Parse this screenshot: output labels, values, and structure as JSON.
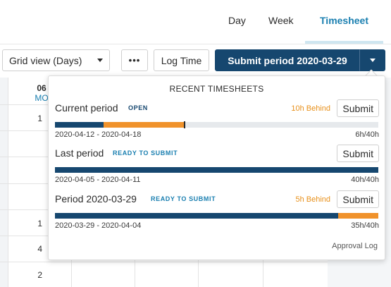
{
  "nav": {
    "tabs": [
      {
        "label": "Day"
      },
      {
        "label": "Week"
      },
      {
        "label": "Timesheet"
      }
    ],
    "active_tab": "Timesheet"
  },
  "toolbar": {
    "grid_view_label": "Grid view (Days)",
    "more_label": "•••",
    "log_time_label": "Log Time",
    "submit_label": "Submit period 2020-03-29"
  },
  "grid": {
    "day_number": "06",
    "day_name": "MO",
    "column_values": [
      "1",
      "1",
      "4",
      "2"
    ]
  },
  "dropdown": {
    "title": "RECENT TIMESHEETS",
    "periods": [
      {
        "name": "Current period",
        "status": "OPEN",
        "behind": "10h Behind",
        "submit_label": "Submit",
        "range": "2020-04-12 - 2020-04-18",
        "hours": "6h/40h",
        "logged_fraction": 0.15,
        "behind_fraction": 0.25
      },
      {
        "name": "Last period",
        "status": "READY TO SUBMIT",
        "behind": "",
        "submit_label": "Submit",
        "range": "2020-04-05 - 2020-04-11",
        "hours": "40h/40h",
        "logged_fraction": 1.0,
        "behind_fraction": 0
      },
      {
        "name": "Period 2020-03-29",
        "status": "READY TO SUBMIT",
        "behind": "5h Behind",
        "submit_label": "Submit",
        "range": "2020-03-29 - 2020-04-04",
        "hours": "35h/40h",
        "logged_fraction": 0.875,
        "behind_fraction": 0.125
      }
    ],
    "approval_log_label": "Approval Log"
  },
  "colors": {
    "primary": "#16476f",
    "accent_link": "#1a7fb0",
    "behind": "#f0922b",
    "status_open": "#16476f",
    "status_ready": "#1a7fb0"
  }
}
